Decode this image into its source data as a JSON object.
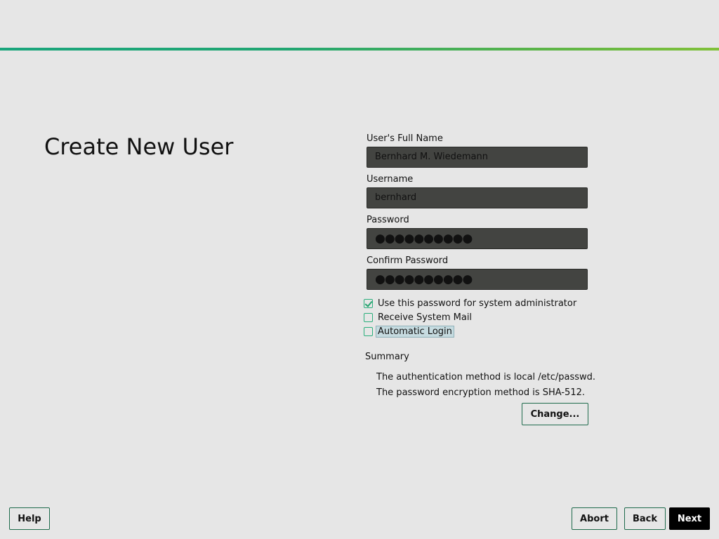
{
  "accent_color": "#1aa57c",
  "page_title": "Create New User",
  "form": {
    "full_name_label": "User's Full Name",
    "full_name_value": "Bernhard M. Wiedemann",
    "username_label": "Username",
    "username_value": "bernhard",
    "password_label": "Password",
    "password_value": "●●●●●●●●●●",
    "confirm_label": "Confirm Password",
    "confirm_value": "●●●●●●●●●●"
  },
  "checkboxes": [
    {
      "label": "Use this password for system administrator",
      "checked": true
    },
    {
      "label": "Receive System Mail",
      "checked": false
    },
    {
      "label": "Automatic Login",
      "checked": false
    }
  ],
  "summary": {
    "heading": "Summary",
    "lines": [
      "The authentication method is local /etc/passwd.",
      "The password encryption method is SHA-512."
    ],
    "change_label": "Change..."
  },
  "footer": {
    "help": "Help",
    "abort": "Abort",
    "back": "Back",
    "next": "Next"
  }
}
